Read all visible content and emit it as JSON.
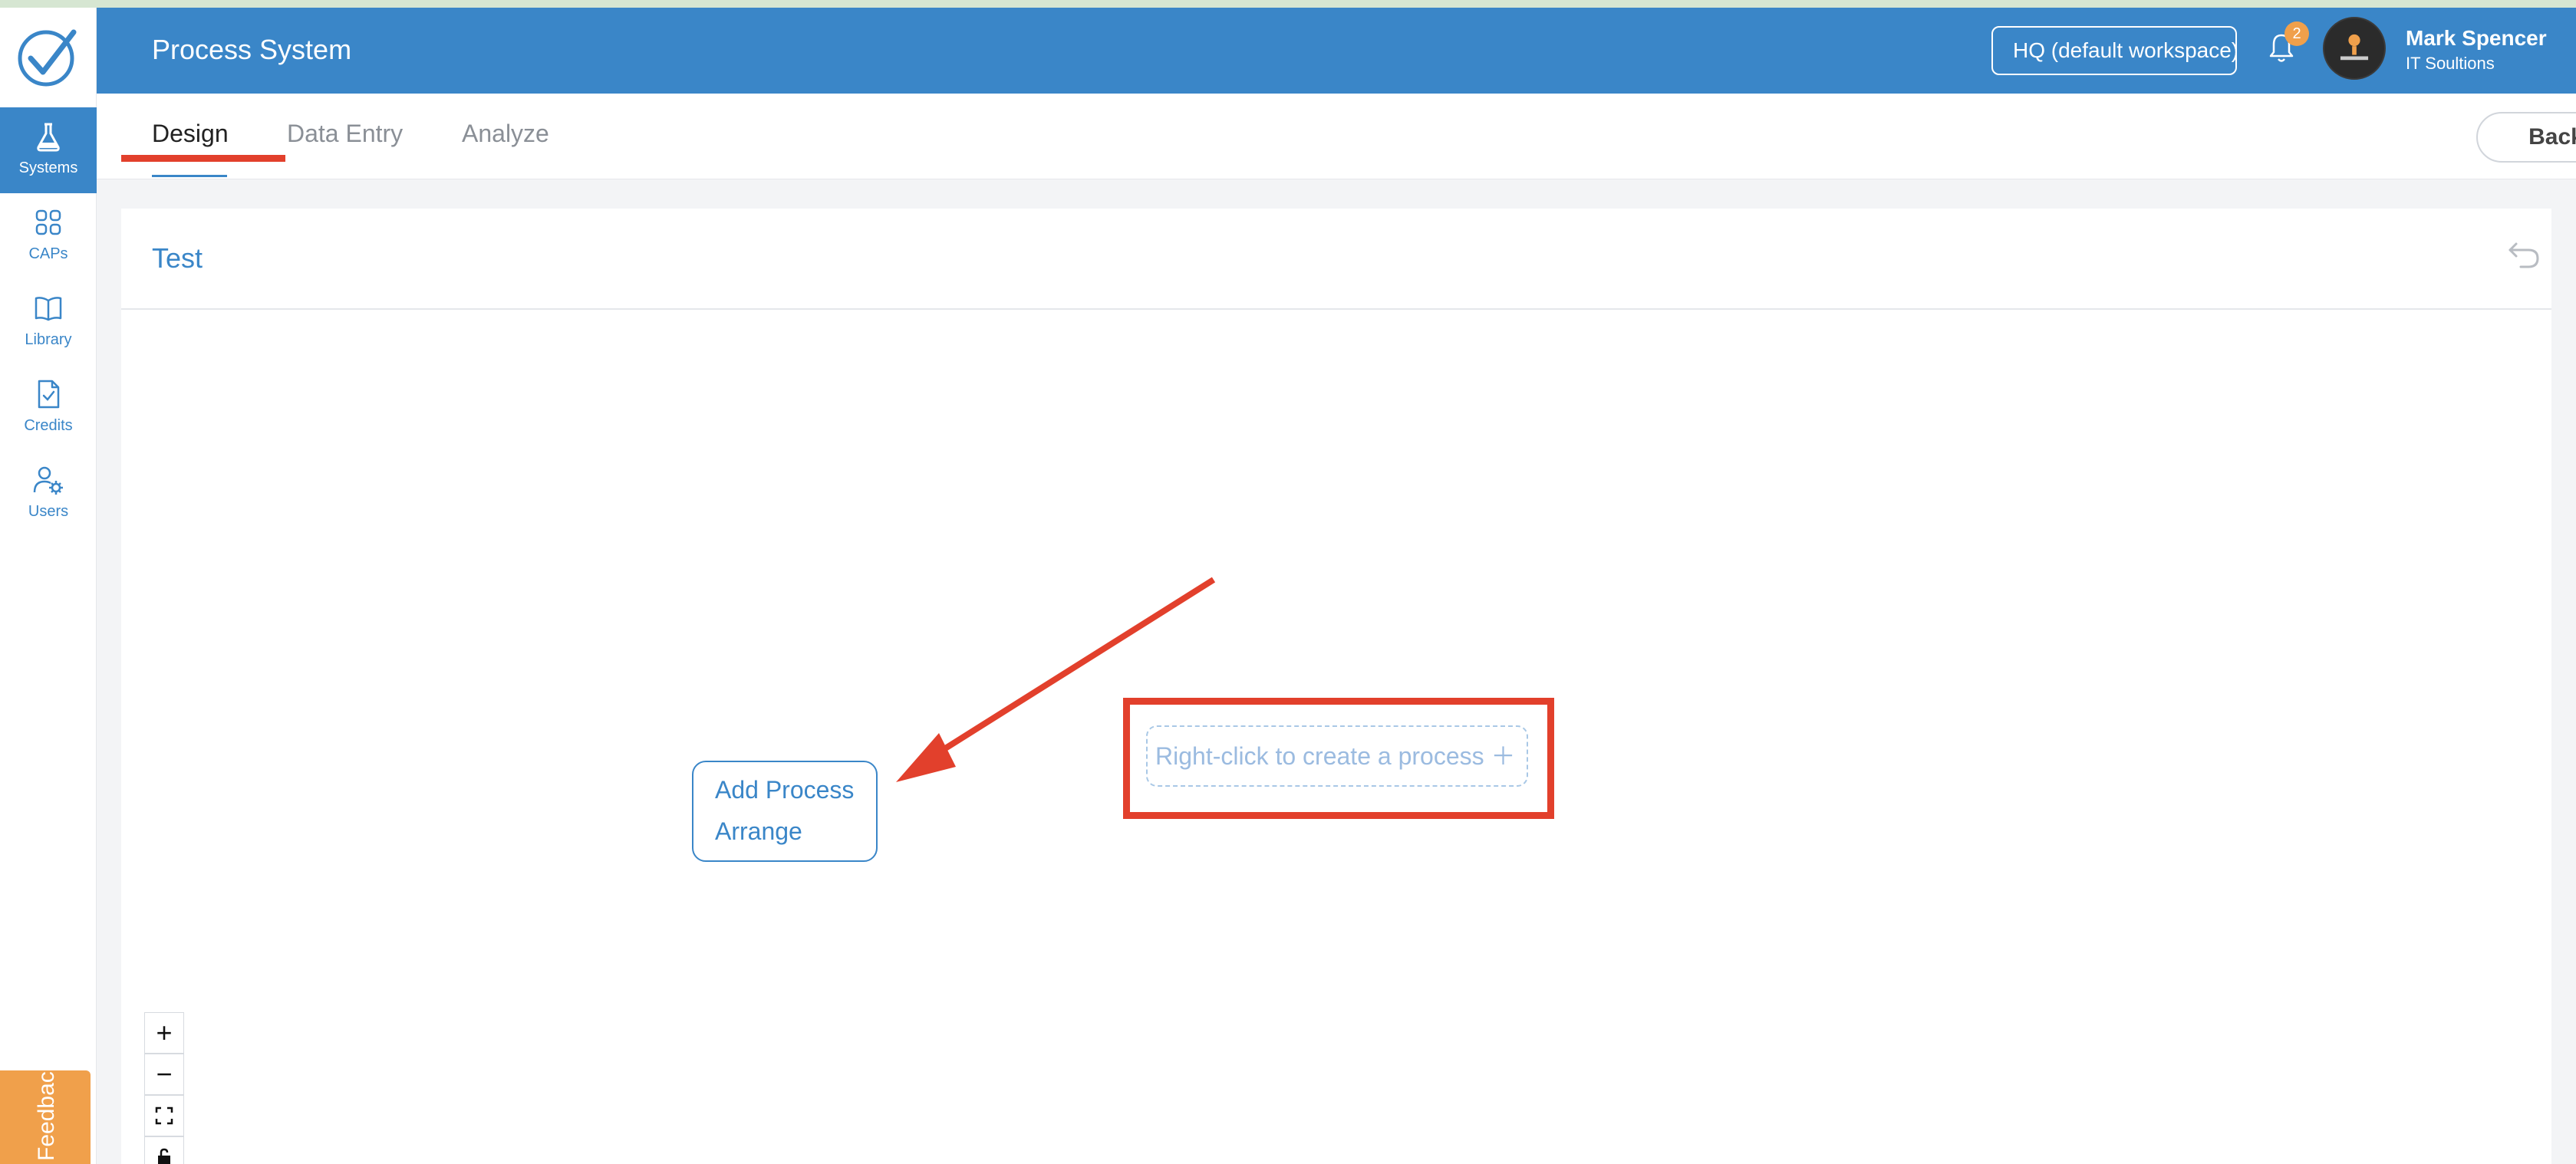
{
  "app": {
    "title": "Process System"
  },
  "sidebar": {
    "items": [
      {
        "label": "Systems",
        "icon": "flask-icon",
        "active": true
      },
      {
        "label": "CAPs",
        "icon": "grid-icon"
      },
      {
        "label": "Library",
        "icon": "book-icon"
      },
      {
        "label": "Credits",
        "icon": "document-check-icon"
      },
      {
        "label": "Users",
        "icon": "user-gear-icon"
      }
    ],
    "feedback_label": "Feedback"
  },
  "header": {
    "workspace": "HQ (default workspace)",
    "notification_count": "2",
    "user_name": "Mark Spencer",
    "user_org": "IT Soultions"
  },
  "tabs": [
    {
      "label": "Design",
      "active": true
    },
    {
      "label": "Data Entry"
    },
    {
      "label": "Analyze"
    }
  ],
  "back_label": "Back",
  "canvas": {
    "title": "Test",
    "context_menu": [
      "Add Process",
      "Arrange"
    ],
    "hint": "Right-click to create a process ＋",
    "zoom": {
      "in": "+",
      "out": "−"
    }
  },
  "colors": {
    "primary": "#3a86c8",
    "annotation": "#e2402c",
    "feedback": "#f0a04b"
  }
}
